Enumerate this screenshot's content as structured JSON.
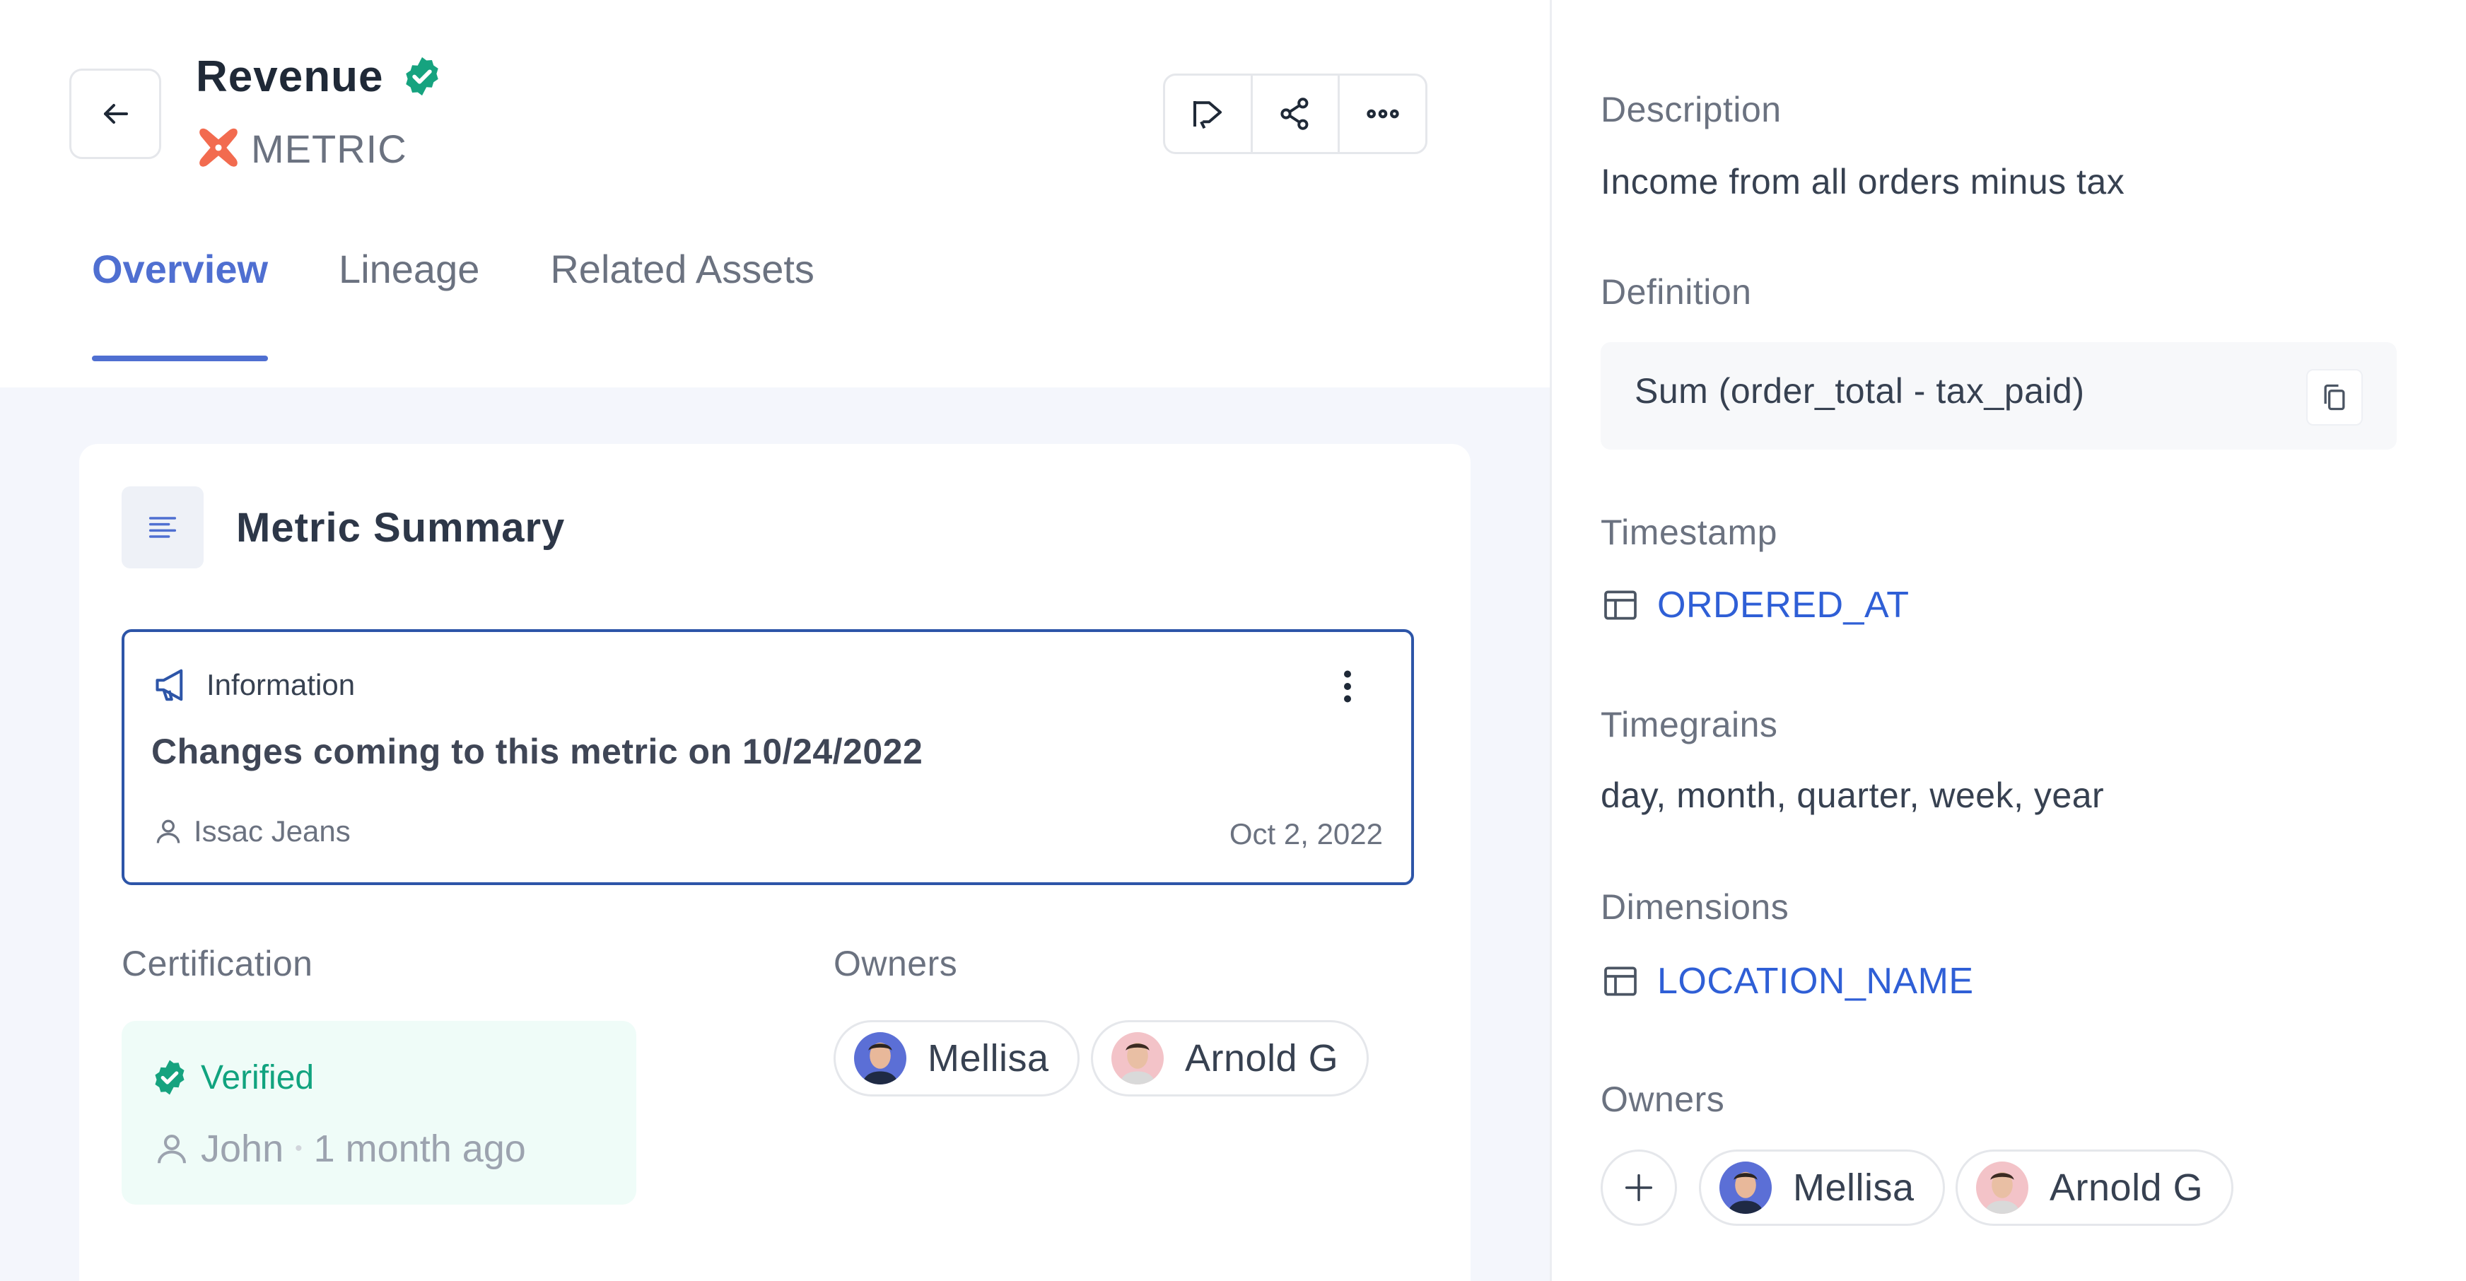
{
  "header": {
    "title": "Revenue",
    "asset_type": "METRIC",
    "back_icon": "arrow-left-icon",
    "certified_icon": "verified-badge-icon",
    "actions": [
      {
        "icon": "announcement-icon"
      },
      {
        "icon": "share-icon"
      },
      {
        "icon": "more-horizontal-icon"
      }
    ]
  },
  "tabs": [
    {
      "label": "Overview",
      "active": true
    },
    {
      "label": "Lineage",
      "active": false
    },
    {
      "label": "Related Assets",
      "active": false
    }
  ],
  "summary": {
    "title": "Metric Summary",
    "announcement": {
      "type_label": "Information",
      "message": "Changes coming to this metric on 10/24/2022",
      "author": "Issac Jeans",
      "date": "Oct 2, 2022"
    },
    "certification": {
      "label": "Certification",
      "status": "Verified",
      "user": "John",
      "separator": "•",
      "time": "1 month ago"
    },
    "owners": {
      "label": "Owners",
      "items": [
        {
          "name": "Mellisa"
        },
        {
          "name": "Arnold G"
        }
      ]
    }
  },
  "sidebar": {
    "description_label": "Description",
    "description": "Income from all orders minus tax",
    "definition_label": "Definition",
    "definition": "Sum (order_total - tax_paid)",
    "timestamp_label": "Timestamp",
    "timestamp": "ORDERED_AT",
    "timegrains_label": "Timegrains",
    "timegrains": "day, month, quarter, week, year",
    "dimensions_label": "Dimensions",
    "dimension": "LOCATION_NAME",
    "owners_label": "Owners",
    "owners": [
      {
        "name": "Mellisa"
      },
      {
        "name": "Arnold G"
      }
    ]
  },
  "colors": {
    "accent": "#4f6fd1",
    "link": "#2f5fd6",
    "verified": "#11a37f",
    "info_border": "#2d55a8",
    "content_bg": "#f4f6fc"
  }
}
